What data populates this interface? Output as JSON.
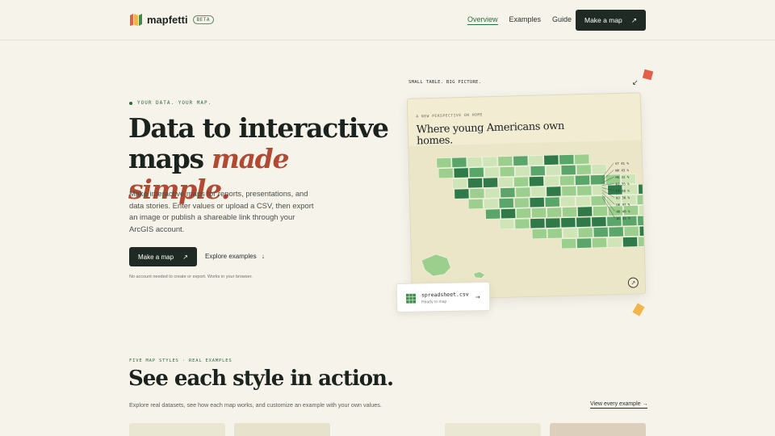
{
  "nav": {
    "brand": "mapfetti",
    "badge": "BETA",
    "links": [
      "Overview",
      "Examples",
      "Guide"
    ],
    "cta": "Make a map",
    "cta_icon": "arrow-up-right-icon"
  },
  "hero": {
    "eyebrow": "YOUR DATA. YOUR MAP.",
    "title_line1": "Data to interactive",
    "title_line2a": "maps",
    "title_line2b": "made simple.",
    "description": "Make interactive maps for reports, presentations, and data stories. Enter values or upload a CSV, then export an image or publish a shareable link through your ArcGIS account.",
    "cta": "Make a map",
    "secondary": "Explore examples",
    "secondary_arrow": "↓",
    "fineprint": "No account needed to create or export. Works in your browser."
  },
  "preview": {
    "tagline": "SMALL TABLE. BIG PICTURE.",
    "kicker": "A NEW PERSPECTIVE ON HOME",
    "title": "Where young Americans own homes.",
    "east_labels": [
      "VT 41 %",
      "NH 43 %",
      "MA 32 %",
      "RI 35 %",
      "CT 38 %",
      "NJ 30 %",
      "DE 47 %",
      "MD 40 %",
      "DC 25 %"
    ],
    "file": {
      "name": "spreadsheet.csv",
      "status": "Ready to map",
      "arrow": "→"
    },
    "colors": {
      "dark": "#2f7a48",
      "mid": "#5aa56a",
      "light": "#9ccf8e",
      "pale": "#cfe5b8"
    }
  },
  "section": {
    "eyebrow": "FIVE MAP STYLES · REAL EXAMPLES",
    "title": "See each style in action.",
    "description": "Explore real datasets, see how each map works, and customize an example with your own values.",
    "view_all": "View every example →"
  }
}
